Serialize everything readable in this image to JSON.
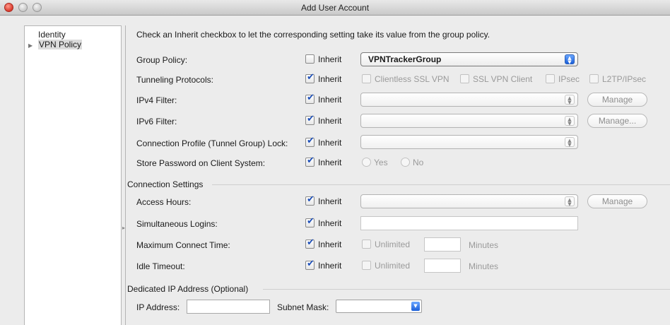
{
  "window": {
    "title": "Add User Account"
  },
  "sidebar": {
    "items": [
      {
        "label": "Identity"
      },
      {
        "label": "VPN Policy"
      }
    ]
  },
  "hint": "Check an Inherit checkbox to let the corresponding setting take its value from the group policy.",
  "inherit_label": "Inherit",
  "rows": {
    "group_policy": {
      "label": "Group Policy:",
      "inherit": false,
      "value": "VPNTrackerGroup"
    },
    "tunneling": {
      "label": "Tunneling Protocols:",
      "inherit": true,
      "options": [
        "Clientless SSL VPN",
        "SSL VPN Client",
        "IPsec",
        "L2TP/IPsec"
      ]
    },
    "ipv4": {
      "label": "IPv4 Filter:",
      "inherit": true,
      "button": "Manage"
    },
    "ipv6": {
      "label": "IPv6 Filter:",
      "inherit": true,
      "button": "Manage..."
    },
    "tunnel_lock": {
      "label": "Connection Profile (Tunnel Group) Lock:",
      "inherit": true
    },
    "store_password": {
      "label": "Store Password on Client System:",
      "inherit": true,
      "yes": "Yes",
      "no": "No"
    }
  },
  "connection_settings": {
    "title": "Connection Settings",
    "access_hours": {
      "label": "Access Hours:",
      "inherit": true,
      "button": "Manage"
    },
    "simultaneous": {
      "label": "Simultaneous Logins:",
      "inherit": true
    },
    "max_connect": {
      "label": "Maximum Connect Time:",
      "inherit": true,
      "unlimited": "Unlimited",
      "unit": "Minutes"
    },
    "idle_timeout": {
      "label": "Idle Timeout:",
      "inherit": true,
      "unlimited": "Unlimited",
      "unit": "Minutes"
    }
  },
  "dedicated_ip": {
    "title": "Dedicated IP Address (Optional)",
    "ip_label": "IP Address:",
    "ip_value": "",
    "mask_label": "Subnet Mask:",
    "mask_value": ""
  }
}
